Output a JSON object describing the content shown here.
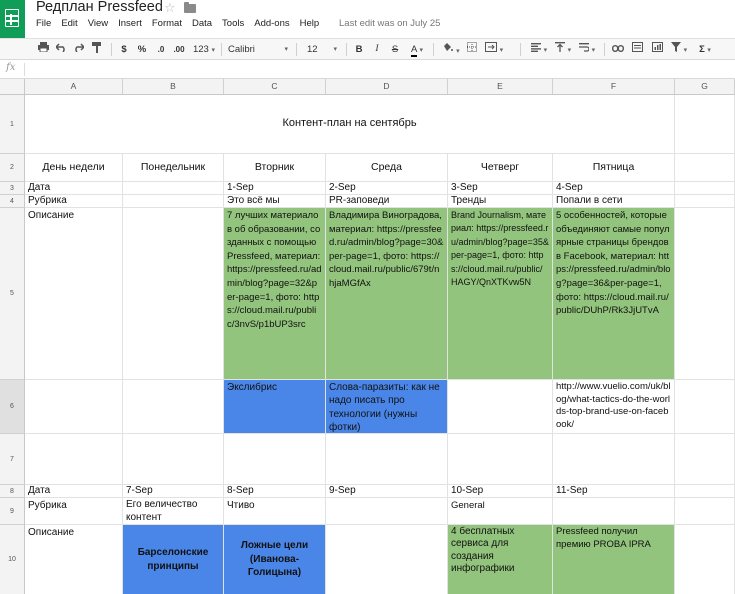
{
  "app": {
    "icon": "sheets-icon",
    "doc_title": "Редплан Pressfeed",
    "last_edit": "Last edit was on July 25",
    "menus": [
      "File",
      "Edit",
      "View",
      "Insert",
      "Format",
      "Data",
      "Tools",
      "Add-ons",
      "Help"
    ]
  },
  "toolbar": {
    "currency": "$",
    "percent": "%",
    "dec_decrease": ".0",
    "dec_increase": ".00",
    "number_format": "123",
    "font_name": "Calibri",
    "font_size": "12",
    "bold": "B",
    "italic": "I",
    "strike": "S",
    "text_color": "A",
    "sum": "Σ",
    "caret": "▾"
  },
  "formula_bar": {
    "fx": "fx",
    "value": ""
  },
  "columns": [
    "A",
    "B",
    "C",
    "D",
    "E",
    "F",
    "G"
  ],
  "rows": [
    "1",
    "2",
    "3",
    "4",
    "5",
    "6",
    "7",
    "8",
    "9",
    "10"
  ],
  "sheet": {
    "title": "Контент-план на сентябрь",
    "days": [
      "День недели",
      "Понедельник",
      "Вторник",
      "Среда",
      "Четверг",
      "Пятница"
    ],
    "week1": {
      "label_date": "Дата",
      "label_rubric": "Рубрика",
      "label_desc": "Описание",
      "dates": [
        "",
        "1-Sep",
        "2-Sep",
        "3-Sep",
        "4-Sep"
      ],
      "rubrics": [
        "",
        "Это всё мы",
        "PR-заповеди",
        "Тренды",
        "Попали в сети"
      ],
      "descriptions": [
        "",
        "7 лучших материалов об образовании, созданных с помощью Pressfeed, материал: https://pressfeed.ru/admin/blog?page=32&per-page=1, фото: https://cloud.mail.ru/public/3nvS/p1bUP3src",
        "Владимира Виноградова, материал: https://pressfeed.ru/admin/blog?page=30&per-page=1, фото: https://cloud.mail.ru/public/679t/nhjaMGfAx",
        "Brand Journalism, материал: https://pressfeed.ru/admin/blog?page=35&per-page=1, фото: https://cloud.mail.ru/public/HAGY/QnXTKvw5N",
        "5 особенностей, которые объединяют самые популярные страницы брендов в Facebook, материал: https://pressfeed.ru/admin/blog?page=36&per-page=1, фото: https://cloud.mail.ru/public/DUhP/Rk3JjUTvA"
      ],
      "extras": [
        "",
        "Экслибрис",
        "Слова-паразиты: как не надо писать про технологии (нужны фотки)",
        "",
        "http://www.vuelio.com/uk/blog/what-tactics-do-the-worlds-top-brand-use-on-facebook/"
      ]
    },
    "week2": {
      "label_date": "Дата",
      "label_rubric": "Рубрика",
      "label_desc": "Описание",
      "dates": [
        "7-Sep",
        "8-Sep",
        "9-Sep",
        "10-Sep",
        "11-Sep"
      ],
      "rubrics": [
        "Его величество контент",
        "Чтиво",
        "",
        "General",
        ""
      ],
      "descriptions": [
        "Барселонские принципы",
        "Ложные цели (Иванова-Голицына)",
        "",
        "4 бесплатных сервиса для создания инфографики",
        "Pressfeed получил премию PROBA IPRA"
      ]
    }
  },
  "colors": {
    "brand_green": "#0f9d58",
    "cell_green": "#93c47d",
    "cell_blue": "#4a86e8"
  }
}
